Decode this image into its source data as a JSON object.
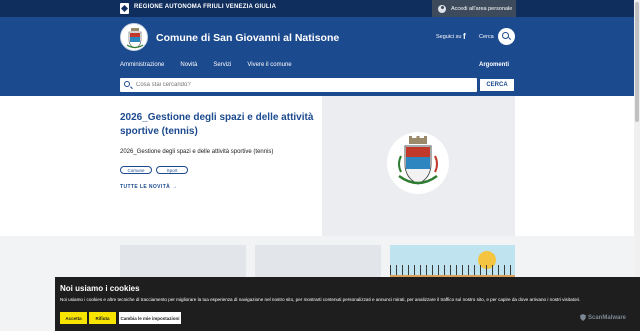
{
  "topbar": {
    "region_name": "REGIONE AUTONOMA FRIULI VENEZIA GIULIA",
    "login_label": "Accedi all'area personale"
  },
  "header": {
    "site_title": "Comune di San Giovanni al Natisone",
    "follow_label": "Seguici su",
    "search_label": "Cerca",
    "nav_items": [
      "Amministrazione",
      "Novità",
      "Servizi",
      "Vivere il comune"
    ],
    "nav_right": "Argomenti",
    "search_placeholder": "Cosa stai cercando?",
    "search_button": "CERCA"
  },
  "main": {
    "title": "2026_Gestione degli spazi e delle attività sportive (tennis)",
    "description": "2026_Gestione degli spazi e delle attività sportive (tennis)",
    "tags": [
      "Comune",
      "Sport"
    ],
    "read_more": "TUTTE LE NOVITÀ"
  },
  "cookie": {
    "title": "Noi usiamo i cookies",
    "text": "Noi usiamo i cookies e altre tecniche di tracciamento per migliorare la tua esperienza di navigazione nel nostro sito, per mostrarti contenuti personalizzati e annunci mirati, per analizzare il traffico sul nostro sito, e per capire da dove arrivano i nostri visitatori.",
    "accept": "Accetta",
    "reject": "Rifiuta",
    "settings": "Cambia le mie impostazioni",
    "badge": "ScanMalware"
  },
  "colors": {
    "header_blue": "#1c4a8f",
    "topbar_navy": "#0f2e5e",
    "cookie_yellow": "#f7e400"
  }
}
